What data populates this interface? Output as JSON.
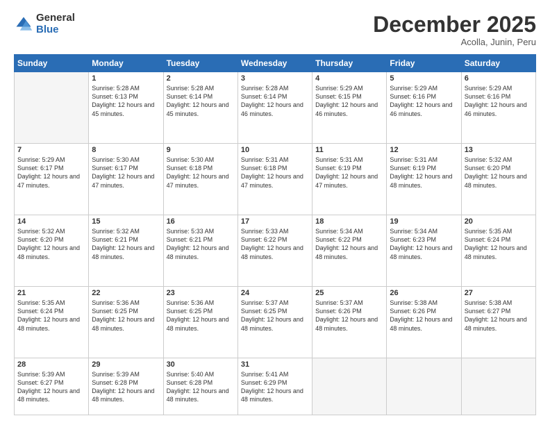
{
  "logo": {
    "general": "General",
    "blue": "Blue"
  },
  "title": "December 2025",
  "subtitle": "Acolla, Junin, Peru",
  "days": [
    "Sunday",
    "Monday",
    "Tuesday",
    "Wednesday",
    "Thursday",
    "Friday",
    "Saturday"
  ],
  "weeks": [
    [
      {
        "day": "",
        "empty": true
      },
      {
        "day": "1",
        "sunrise": "5:28 AM",
        "sunset": "6:13 PM",
        "daylight": "12 hours and 45 minutes."
      },
      {
        "day": "2",
        "sunrise": "5:28 AM",
        "sunset": "6:14 PM",
        "daylight": "12 hours and 45 minutes."
      },
      {
        "day": "3",
        "sunrise": "5:28 AM",
        "sunset": "6:14 PM",
        "daylight": "12 hours and 46 minutes."
      },
      {
        "day": "4",
        "sunrise": "5:29 AM",
        "sunset": "6:15 PM",
        "daylight": "12 hours and 46 minutes."
      },
      {
        "day": "5",
        "sunrise": "5:29 AM",
        "sunset": "6:16 PM",
        "daylight": "12 hours and 46 minutes."
      },
      {
        "day": "6",
        "sunrise": "5:29 AM",
        "sunset": "6:16 PM",
        "daylight": "12 hours and 46 minutes."
      }
    ],
    [
      {
        "day": "7",
        "sunrise": "5:29 AM",
        "sunset": "6:17 PM",
        "daylight": "12 hours and 47 minutes."
      },
      {
        "day": "8",
        "sunrise": "5:30 AM",
        "sunset": "6:17 PM",
        "daylight": "12 hours and 47 minutes."
      },
      {
        "day": "9",
        "sunrise": "5:30 AM",
        "sunset": "6:18 PM",
        "daylight": "12 hours and 47 minutes."
      },
      {
        "day": "10",
        "sunrise": "5:31 AM",
        "sunset": "6:18 PM",
        "daylight": "12 hours and 47 minutes."
      },
      {
        "day": "11",
        "sunrise": "5:31 AM",
        "sunset": "6:19 PM",
        "daylight": "12 hours and 47 minutes."
      },
      {
        "day": "12",
        "sunrise": "5:31 AM",
        "sunset": "6:19 PM",
        "daylight": "12 hours and 48 minutes."
      },
      {
        "day": "13",
        "sunrise": "5:32 AM",
        "sunset": "6:20 PM",
        "daylight": "12 hours and 48 minutes."
      }
    ],
    [
      {
        "day": "14",
        "sunrise": "5:32 AM",
        "sunset": "6:20 PM",
        "daylight": "12 hours and 48 minutes."
      },
      {
        "day": "15",
        "sunrise": "5:32 AM",
        "sunset": "6:21 PM",
        "daylight": "12 hours and 48 minutes."
      },
      {
        "day": "16",
        "sunrise": "5:33 AM",
        "sunset": "6:21 PM",
        "daylight": "12 hours and 48 minutes."
      },
      {
        "day": "17",
        "sunrise": "5:33 AM",
        "sunset": "6:22 PM",
        "daylight": "12 hours and 48 minutes."
      },
      {
        "day": "18",
        "sunrise": "5:34 AM",
        "sunset": "6:22 PM",
        "daylight": "12 hours and 48 minutes."
      },
      {
        "day": "19",
        "sunrise": "5:34 AM",
        "sunset": "6:23 PM",
        "daylight": "12 hours and 48 minutes."
      },
      {
        "day": "20",
        "sunrise": "5:35 AM",
        "sunset": "6:24 PM",
        "daylight": "12 hours and 48 minutes."
      }
    ],
    [
      {
        "day": "21",
        "sunrise": "5:35 AM",
        "sunset": "6:24 PM",
        "daylight": "12 hours and 48 minutes."
      },
      {
        "day": "22",
        "sunrise": "5:36 AM",
        "sunset": "6:25 PM",
        "daylight": "12 hours and 48 minutes."
      },
      {
        "day": "23",
        "sunrise": "5:36 AM",
        "sunset": "6:25 PM",
        "daylight": "12 hours and 48 minutes."
      },
      {
        "day": "24",
        "sunrise": "5:37 AM",
        "sunset": "6:25 PM",
        "daylight": "12 hours and 48 minutes."
      },
      {
        "day": "25",
        "sunrise": "5:37 AM",
        "sunset": "6:26 PM",
        "daylight": "12 hours and 48 minutes."
      },
      {
        "day": "26",
        "sunrise": "5:38 AM",
        "sunset": "6:26 PM",
        "daylight": "12 hours and 48 minutes."
      },
      {
        "day": "27",
        "sunrise": "5:38 AM",
        "sunset": "6:27 PM",
        "daylight": "12 hours and 48 minutes."
      }
    ],
    [
      {
        "day": "28",
        "sunrise": "5:39 AM",
        "sunset": "6:27 PM",
        "daylight": "12 hours and 48 minutes."
      },
      {
        "day": "29",
        "sunrise": "5:39 AM",
        "sunset": "6:28 PM",
        "daylight": "12 hours and 48 minutes."
      },
      {
        "day": "30",
        "sunrise": "5:40 AM",
        "sunset": "6:28 PM",
        "daylight": "12 hours and 48 minutes."
      },
      {
        "day": "31",
        "sunrise": "5:41 AM",
        "sunset": "6:29 PM",
        "daylight": "12 hours and 48 minutes."
      },
      {
        "day": "",
        "empty": true
      },
      {
        "day": "",
        "empty": true
      },
      {
        "day": "",
        "empty": true
      }
    ]
  ]
}
